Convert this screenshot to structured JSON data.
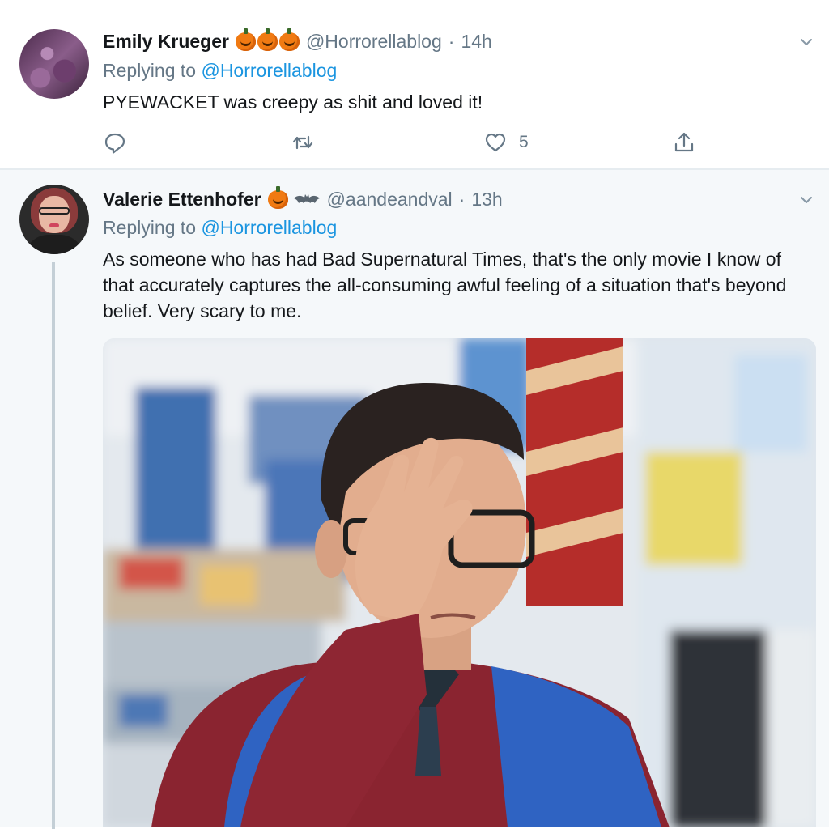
{
  "tweets": [
    {
      "author": "Emily Krueger",
      "name_emojis": [
        "pumpkin-icon",
        "pumpkin-icon",
        "pumpkin-icon"
      ],
      "handle": "@Horrorellablog",
      "separator": "·",
      "time": "14h",
      "replying_prefix": "Replying to",
      "replying_to": "@Horrorellablog",
      "text": "PYEWACKET was creepy as shit and loved it!",
      "actions": {
        "reply_count": "",
        "retweet_count": "",
        "like_count": "5"
      }
    },
    {
      "author": "Valerie Ettenhofer",
      "name_emojis": [
        "pumpkin-icon",
        "bat-icon"
      ],
      "handle": "@aandeandval",
      "separator": "·",
      "time": "13h",
      "replying_prefix": "Replying to",
      "replying_to": "@Horrorellablog",
      "text": "As someone who has had Bad Supernatural Times, that's the only movie I know of that accurately captures the all-consuming awful feeling of a situation that's beyond belief. Very scary to me.",
      "media": {
        "type": "gif",
        "description_icon": "facepalm-gif"
      }
    }
  ],
  "colors": {
    "link": "#1b95e0",
    "secondary_text": "#657786",
    "primary_text": "#14171a",
    "thread_line": "#c4cfd6",
    "reply_background": "#f5f8fa"
  }
}
